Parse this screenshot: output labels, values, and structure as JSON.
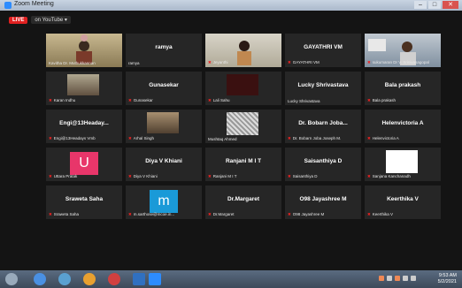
{
  "window": {
    "title": "Zoom Meeting",
    "buttons": [
      "–",
      "□",
      "✕"
    ]
  },
  "live": {
    "badge": "LIVE",
    "platform": "on YouTube ▾"
  },
  "tiles": [
    {
      "bigname": "",
      "label": "Kavitha Dr. Muthukkannan",
      "muted": false,
      "kind": "video-person",
      "active": true
    },
    {
      "bigname": "ramya",
      "label": "ramya",
      "muted": false,
      "kind": "name"
    },
    {
      "bigname": "",
      "label": "Jeyanthi",
      "muted": true,
      "kind": "video-person2"
    },
    {
      "bigname": "GAYATHRI VM",
      "label": "GAYATHRI VM",
      "muted": true,
      "kind": "name"
    },
    {
      "bigname": "",
      "label": "sukumaran Dr V. Srinivasagopal",
      "muted": true,
      "kind": "video-person3"
    },
    {
      "bigname": "",
      "label": "Karan Indhu",
      "muted": true,
      "kind": "photo-small"
    },
    {
      "bigname": "Gunasekar",
      "label": "Gunasekar",
      "muted": true,
      "kind": "name"
    },
    {
      "bigname": "",
      "label": "Lali Sahu",
      "muted": true,
      "kind": "dark-photo"
    },
    {
      "bigname": "Lucky Shrivastava",
      "label": "Lucky Shrivastava",
      "muted": false,
      "kind": "name"
    },
    {
      "bigname": "Bala prakash",
      "label": "Bala prakash",
      "muted": true,
      "kind": "name"
    },
    {
      "bigname": "Engi@13Headay...",
      "label": "Engi@13Headays Vmb",
      "muted": true,
      "kind": "name"
    },
    {
      "bigname": "",
      "label": "Arhal Singh",
      "muted": true,
      "kind": "photo-small2"
    },
    {
      "bigname": "",
      "label": "Mushtaq Ahmed",
      "muted": false,
      "kind": "comic"
    },
    {
      "bigname": "Dr. Bobarn Joba...",
      "label": "Dr. Bobarn Joba Joseph M.",
      "muted": true,
      "kind": "name"
    },
    {
      "bigname": "Helenvictoria A",
      "label": "Helenvictoria A",
      "muted": true,
      "kind": "name"
    },
    {
      "bigname": "",
      "label": "Uttara Pratak",
      "muted": true,
      "kind": "avatar-u"
    },
    {
      "bigname": "Diya V Khiani",
      "label": "Diya V Khiani",
      "muted": true,
      "kind": "name"
    },
    {
      "bigname": "Ranjani M I T",
      "label": "Ranjani M I T",
      "muted": true,
      "kind": "name"
    },
    {
      "bigname": "Saisanthiya D",
      "label": "Saisanthiya D",
      "muted": true,
      "kind": "name"
    },
    {
      "bigname": "",
      "label": "Sanjana Kanchanadh",
      "muted": true,
      "kind": "white"
    },
    {
      "bigname": "Sraweta Saha",
      "label": "Sraweta Saha",
      "muted": true,
      "kind": "name"
    },
    {
      "bigname": "",
      "label": "m.sarthose@mcoe.in...",
      "muted": true,
      "kind": "avatar-m"
    },
    {
      "bigname": "Dr.Margaret",
      "label": "Dr.Margaret",
      "muted": true,
      "kind": "name"
    },
    {
      "bigname": "O98 Jayashree M",
      "label": "O98 Jayashree M",
      "muted": true,
      "kind": "name"
    },
    {
      "bigname": "Keerthika V",
      "label": "Keerthika V",
      "muted": true,
      "kind": "name"
    }
  ],
  "taskbar": {
    "time": "9:53 AM",
    "date": "5/2/2021"
  },
  "colors": {
    "active_border": "#b7e35a",
    "mute": "#e22222",
    "avatar_u": "#e8366a",
    "avatar_m": "#1a9ad8"
  }
}
